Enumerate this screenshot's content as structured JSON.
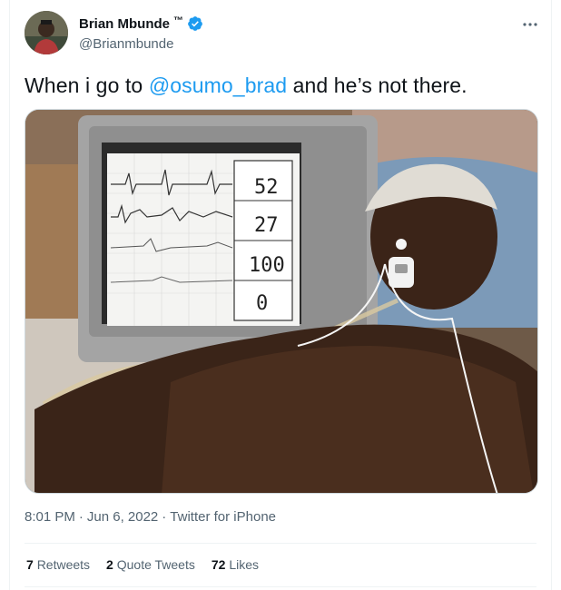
{
  "author": {
    "display_name": "Brian Mbunde",
    "tm": "™",
    "handle": "@Brianmbunde",
    "verified": true,
    "verified_color": "#1d9bf0"
  },
  "tweet": {
    "text_before": "When i go to ",
    "mention": "@osumo_brad",
    "text_after": " and he’s not there.",
    "mention_color": "#1d9bf0"
  },
  "media": {
    "monitor_readings": [
      "52",
      "27",
      "100",
      "0"
    ]
  },
  "meta": {
    "time": "8:01 PM",
    "sep1": "·",
    "date": "Jun 6, 2022",
    "sep2": "·",
    "source": "Twitter for iPhone"
  },
  "stats": {
    "retweets_count": "7",
    "retweets_label": "Retweets",
    "quotes_count": "2",
    "quotes_label": "Quote Tweets",
    "likes_count": "72",
    "likes_label": "Likes"
  },
  "icons": {
    "more": "more-horizontal-icon",
    "verified": "verified-badge-icon"
  }
}
